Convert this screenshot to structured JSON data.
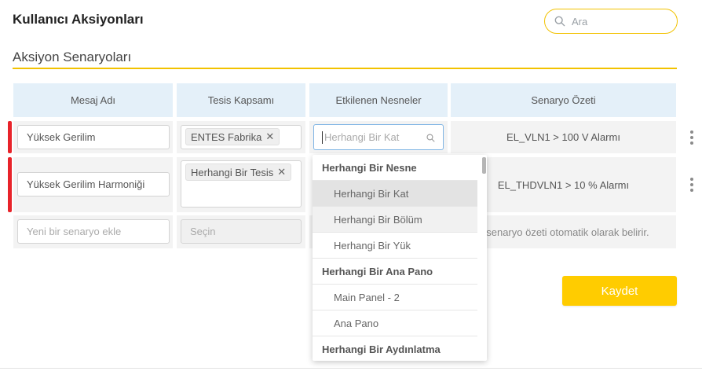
{
  "header": {
    "title": "Kullanıcı Aksiyonları",
    "search_placeholder": "Ara"
  },
  "section": {
    "title": "Aksiyon Senaryoları"
  },
  "table": {
    "columns": [
      "Mesaj Adı",
      "Tesis Kapsamı",
      "Etkilenen Nesneler",
      "Senaryo Özeti"
    ],
    "rows": [
      {
        "message": "Yüksek Gerilim",
        "facility_tag": "ENTES Fabrika",
        "objects_placeholder": "Herhangi Bir Kat",
        "summary": "EL_VLN1 > 100 V Alarmı"
      },
      {
        "message": "Yüksek Gerilim Harmoniği",
        "facility_tag": "Herhangi Bir Tesis",
        "summary": "EL_THDVLN1 > 10 % Alarmı"
      }
    ],
    "new_row": {
      "message_placeholder": "Yeni bir senaryo ekle",
      "facility_placeholder": "Seçin",
      "summary_hint": "nsenaryo özeti otomatik olarak belirir."
    }
  },
  "dropdown": {
    "items": [
      {
        "label": "Herhangi Bir Nesne",
        "kind": "group"
      },
      {
        "label": "Herhangi Bir Kat",
        "kind": "option",
        "state": "selected"
      },
      {
        "label": "Herhangi Bir Bölüm",
        "kind": "option",
        "state": "hover"
      },
      {
        "label": "Herhangi Bir Yük",
        "kind": "option"
      },
      {
        "label": "Herhangi Bir Ana Pano",
        "kind": "group"
      },
      {
        "label": "Main Panel - 2",
        "kind": "option"
      },
      {
        "label": "Ana Pano",
        "kind": "option"
      },
      {
        "label": "Herhangi Bir Aydınlatma",
        "kind": "group"
      }
    ]
  },
  "actions": {
    "save_label": "Kaydet"
  },
  "icons": {
    "search": "search-icon",
    "remove": "close-icon",
    "row_menu": "more-vertical-icon"
  },
  "colors": {
    "accent": "#ffcc00",
    "header_bg": "#e4f0f9",
    "row_marker": "#e8232a",
    "focus_border": "#7fb4e4"
  }
}
